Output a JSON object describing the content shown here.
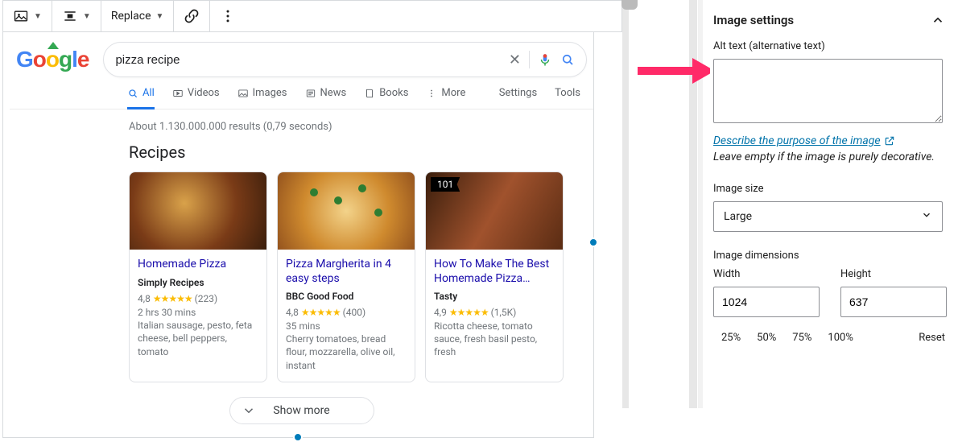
{
  "toolbar": {
    "replace_label": "Replace"
  },
  "google": {
    "query": "pizza recipe",
    "tabs": {
      "all": "All",
      "videos": "Videos",
      "images": "Images",
      "news": "News",
      "books": "Books",
      "more": "More",
      "settings": "Settings",
      "tools": "Tools"
    },
    "stats": "About 1.130.000.000 results (0,79 seconds)",
    "section_title": "Recipes",
    "recipes": [
      {
        "title": "Homemade Pizza",
        "source": "Simply Recipes",
        "rating_value": "4,8",
        "rating_count": "(223)",
        "time": "2 hrs 30 mins",
        "ingredients": "Italian sausage, pesto, feta cheese, bell peppers, tomato"
      },
      {
        "title": "Pizza Margherita in 4 easy steps",
        "source": "BBC Good Food",
        "rating_value": "4,8",
        "rating_count": "(400)",
        "time": "35 mins",
        "ingredients": "Cherry tomatoes, bread flour, mozzarella, olive oil, instant"
      },
      {
        "title": "How To Make The Best Homemade Pizza…",
        "source": "Tasty",
        "rating_value": "4,9",
        "rating_count": "(1,5K)",
        "time": "",
        "ingredients": "Ricotta cheese, tomato sauce, fresh basil pesto, fresh"
      }
    ],
    "badge101": "101",
    "show_more": "Show more"
  },
  "sidebar": {
    "panel_title": "Image settings",
    "alt_label": "Alt text (alternative text)",
    "alt_value": "",
    "describe_link": "Describe the purpose of the image",
    "help_text": "Leave empty if the image is purely decorative.",
    "size_label": "Image size",
    "size_value": "Large",
    "dim_label": "Image dimensions",
    "width_label": "Width",
    "width_value": "1024",
    "height_label": "Height",
    "height_value": "637",
    "pct": {
      "p25": "25%",
      "p50": "50%",
      "p75": "75%",
      "p100": "100%"
    },
    "reset": "Reset"
  }
}
